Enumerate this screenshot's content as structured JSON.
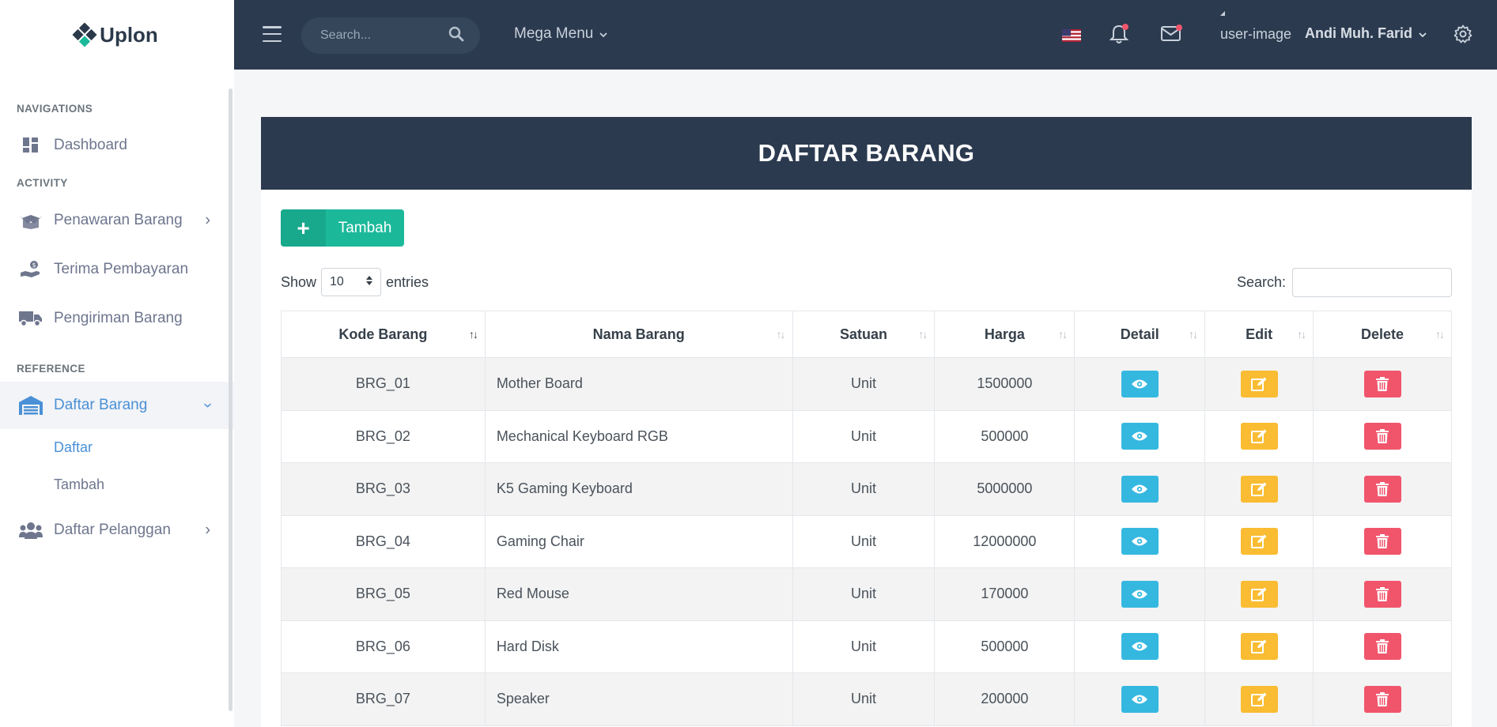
{
  "app": {
    "logo_text": "Uplon"
  },
  "sidebar": {
    "sections": {
      "navigations": "NAVIGATIONS",
      "activity": "ACTIVITY",
      "reference": "REFERENCE"
    },
    "items": [
      {
        "label": "Dashboard",
        "icon": "dashboard-icon"
      },
      {
        "label": "Penawaran Barang",
        "icon": "box-open-icon"
      },
      {
        "label": "Terima Pembayaran",
        "icon": "hand-money-icon"
      },
      {
        "label": "Pengiriman Barang",
        "icon": "truck-icon"
      },
      {
        "label": "Daftar Barang",
        "icon": "warehouse-icon"
      },
      {
        "label": "Daftar Pelanggan",
        "icon": "users-icon"
      }
    ],
    "submenu": [
      {
        "label": "Daftar"
      },
      {
        "label": "Tambah"
      }
    ]
  },
  "topbar": {
    "search_placeholder": "Search...",
    "mega_menu": "Mega Menu",
    "user_image_alt": "user-image",
    "user_name": "Andi Muh. Farid"
  },
  "card": {
    "title": "DAFTAR BARANG",
    "add_button": "Tambah",
    "show_label": "Show",
    "entries_value": "10",
    "entries_label": "entries",
    "search_label": "Search:"
  },
  "table": {
    "headers": [
      "Kode Barang",
      "Nama Barang",
      "Satuan",
      "Harga",
      "Detail",
      "Edit",
      "Delete"
    ],
    "rows": [
      [
        "BRG_01",
        "Mother Board",
        "Unit",
        "1500000"
      ],
      [
        "BRG_02",
        "Mechanical Keyboard RGB",
        "Unit",
        "500000"
      ],
      [
        "BRG_03",
        "K5 Gaming Keyboard",
        "Unit",
        "5000000"
      ],
      [
        "BRG_04",
        "Gaming Chair",
        "Unit",
        "12000000"
      ],
      [
        "BRG_05",
        "Red Mouse",
        "Unit",
        "170000"
      ],
      [
        "BRG_06",
        "Hard Disk",
        "Unit",
        "500000"
      ],
      [
        "BRG_07",
        "Speaker",
        "Unit",
        "200000"
      ]
    ]
  },
  "colors": {
    "topbar": "#2b3a4f",
    "accent_green": "#1bb99a",
    "info": "#35b8e0",
    "warning": "#f9bc32",
    "danger": "#f1556c",
    "active_link": "#4a90d6"
  }
}
